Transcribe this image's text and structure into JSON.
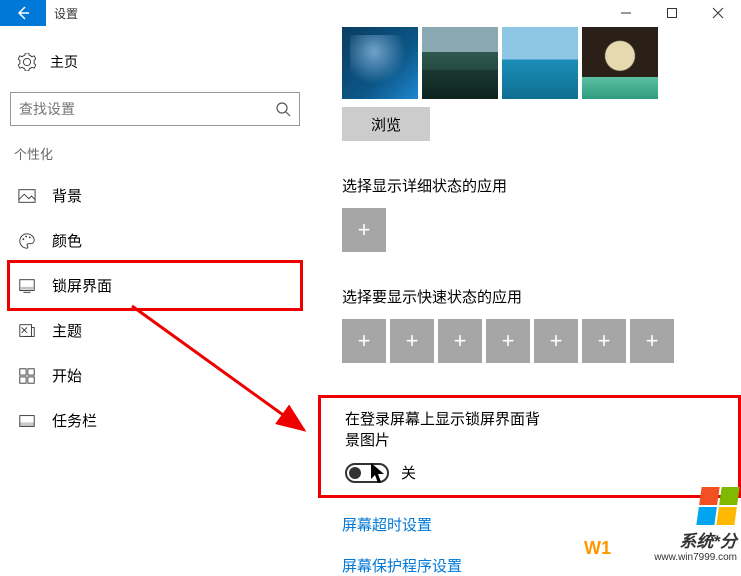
{
  "window": {
    "title": "设置"
  },
  "sidebar": {
    "home": "主页",
    "search_placeholder": "查找设置",
    "section": "个性化",
    "items": [
      {
        "label": "背景"
      },
      {
        "label": "颜色"
      },
      {
        "label": "锁屏界面"
      },
      {
        "label": "主题"
      },
      {
        "label": "开始"
      },
      {
        "label": "任务栏"
      }
    ]
  },
  "main": {
    "browse": "浏览",
    "detail_app_heading": "选择显示详细状态的应用",
    "quick_app_heading": "选择要显示快速状态的应用",
    "toggle_label": "在登录屏幕上显示锁屏界面背景图片",
    "toggle_state": "关",
    "link_timeout": "屏幕超时设置",
    "link_saver": "屏幕保护程序设置"
  },
  "watermark": {
    "brand": "系统*分",
    "url": "www.win7999.com",
    "stub": "W1"
  }
}
